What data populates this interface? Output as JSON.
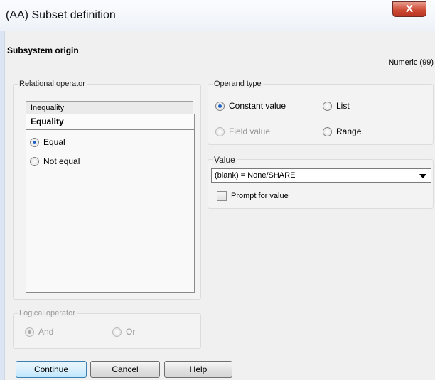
{
  "window": {
    "title": "(AA) Subset definition",
    "close_label": "X"
  },
  "header": {
    "section_title": "Subsystem origin",
    "numeric_label": "Numeric (99)"
  },
  "relational": {
    "label": "Relational operator",
    "tabs": [
      "Inequality",
      "Equality"
    ],
    "options": [
      {
        "label": "Equal",
        "checked": true
      },
      {
        "label": "Not equal",
        "checked": false
      }
    ]
  },
  "logical": {
    "label": "Logical operator",
    "options": [
      {
        "label": "And",
        "checked": true
      },
      {
        "label": "Or",
        "checked": false
      }
    ]
  },
  "operand": {
    "label": "Operand type",
    "options": [
      {
        "label": "Constant value",
        "checked": true
      },
      {
        "label": "List",
        "checked": false
      },
      {
        "label": "Field value",
        "checked": false
      },
      {
        "label": "Range",
        "checked": false
      }
    ]
  },
  "value": {
    "label": "Value",
    "selected": "(blank) = None/SHARE",
    "prompt_label": "Prompt for value"
  },
  "buttons": {
    "continue": "Continue",
    "cancel": "Cancel",
    "help": "Help"
  }
}
